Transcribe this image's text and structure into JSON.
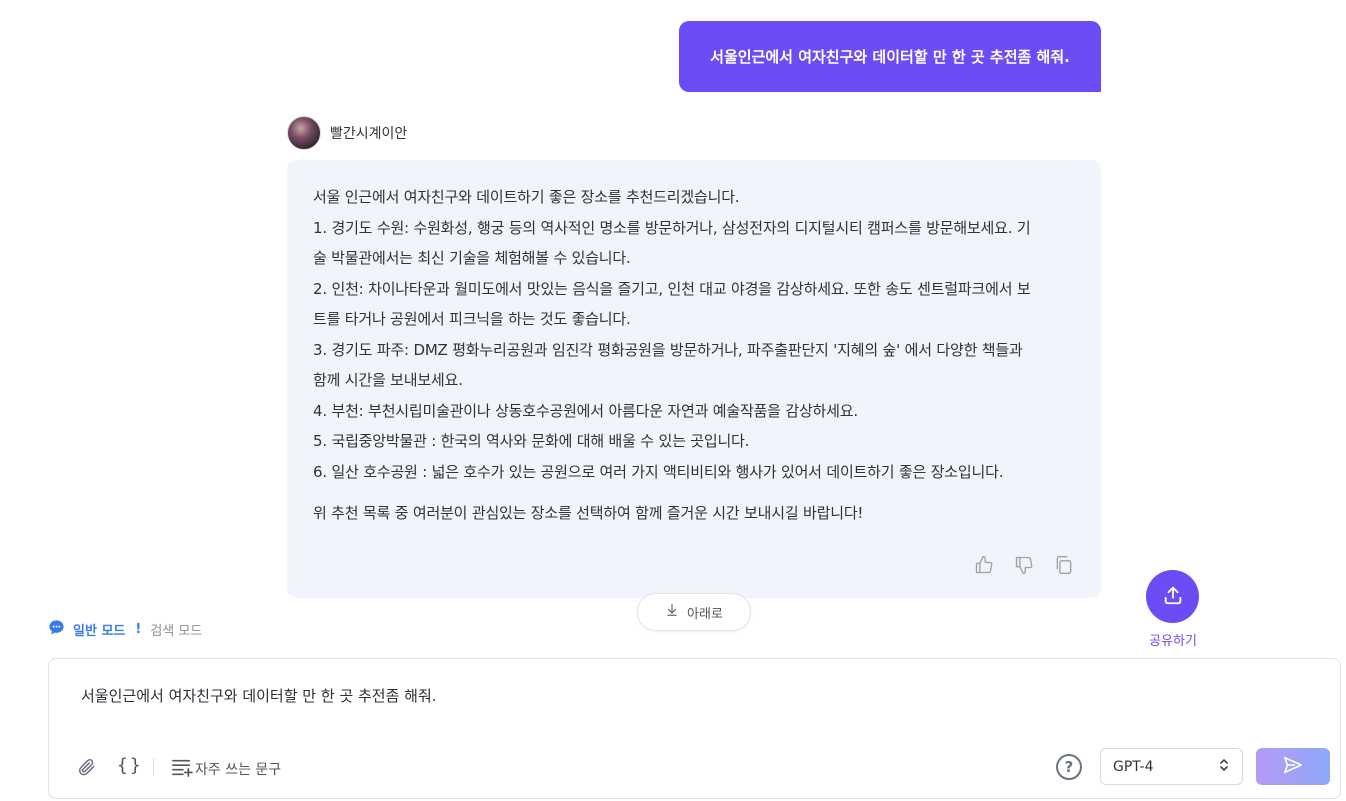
{
  "conversation": {
    "user_message": "서울인근에서 여자친구와 데이터할 만 한 곳 추전좀 해줘.",
    "bot_name": "빨간시계이안",
    "answer_lines": [
      "서울 인근에서 여자친구와 데이트하기 좋은 장소를 추천드리겠습니다.",
      "1. 경기도 수원: 수원화성, 행궁 등의 역사적인 명소를 방문하거나, 삼성전자의 디지털시티 캠퍼스를 방문해보세요. 기",
      "술 박물관에서는 최신 기술을 체험해볼 수 있습니다.",
      "2. 인천: 차이나타운과 월미도에서 맛있는 음식을 즐기고, 인천 대교 야경을 감상하세요. 또한 송도 센트럴파크에서 보",
      "트를 타거나 공원에서 피크닉을 하는 것도 좋습니다.",
      "3. 경기도 파주: DMZ 평화누리공원과 임진각 평화공원을 방문하거나, 파주출판단지 '지혜의 숲' 에서 다양한 책들과",
      "함께 시간을 보내보세요.",
      "4. 부천: 부천시립미술관이나 상동호수공원에서 아름다운 자연과 예술작품을 감상하세요.",
      "5. 국립중앙박물관 : 한국의 역사와 문화에 대해 배울 수 있는 곳입니다.",
      "6. 일산 호수공원 : 넓은 호수가 있는 공원으로 여러 가지 액티비티와 행사가 있어서 데이트하기 좋은 장소입니다."
    ],
    "answer_closing": "위 추천 목록 중 여러분이 관심있는 장소를 선택하여 함께 즐거운 시간 보내시길 바랍니다!"
  },
  "scroll_down_label": "아래로",
  "share_label": "공유하기",
  "modes": {
    "general": "일반 모드",
    "separator": "!",
    "search": "검색 모드"
  },
  "input": {
    "value": "서울인근에서 여자친구와 데이터할 만 한 곳 추전좀 해줘.",
    "braces": "{}",
    "phrases_label": "자주 쓰는 문구",
    "model": "GPT-4"
  },
  "colors": {
    "accent": "#6c4df5",
    "mode_blue": "#3b7be8",
    "card_bg": "#f1f4fb"
  }
}
